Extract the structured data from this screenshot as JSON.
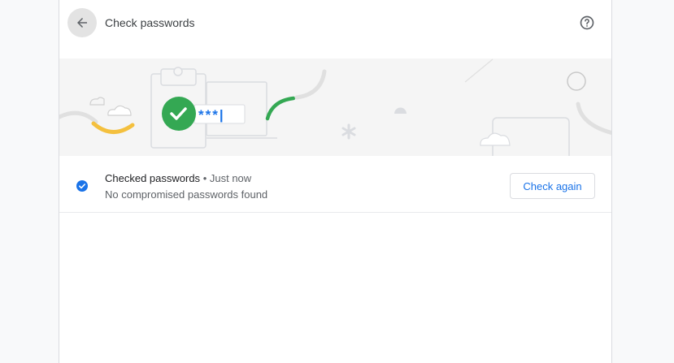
{
  "header": {
    "title": "Check passwords"
  },
  "illustration": {
    "masked_password": "***|"
  },
  "status": {
    "label": "Checked passwords",
    "separator": "•",
    "time": "Just now",
    "detail": "No compromised passwords found",
    "check_again_label": "Check again"
  },
  "colors": {
    "accent_blue": "#1a73e8",
    "success_green": "#34a853",
    "warning_yellow": "#fbbc04",
    "back_button_bg": "#e3e3e3",
    "banner_bg": "#f5f5f5"
  },
  "icons": {
    "back": "arrow-back-icon",
    "help": "help-circle-icon",
    "status": "check-circle-icon"
  }
}
